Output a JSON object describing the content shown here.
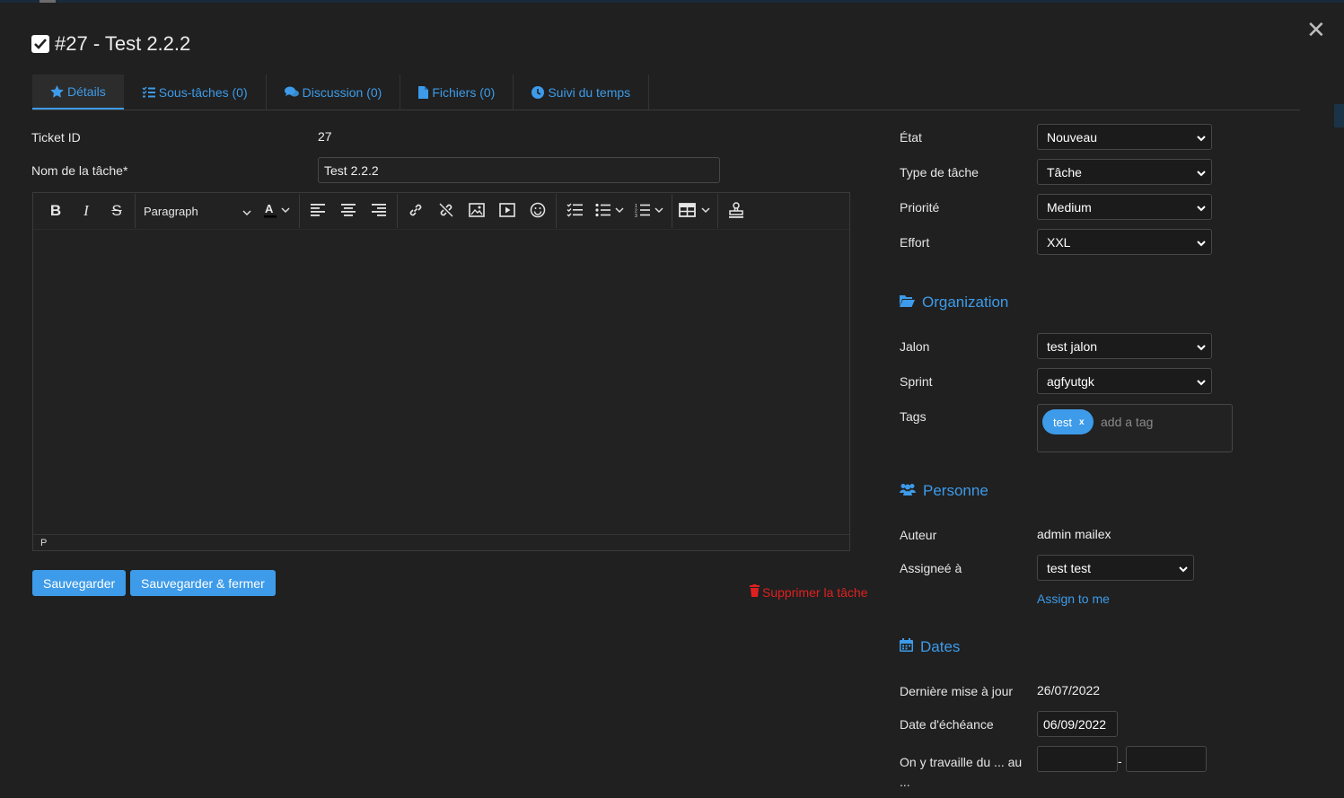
{
  "task": {
    "title": "#27 - Test 2.2.2"
  },
  "tabs": [
    {
      "label": "Détails",
      "icon": "star-icon"
    },
    {
      "label": "Sous-tâches (0)",
      "icon": "checklist-icon"
    },
    {
      "label": "Discussion (0)",
      "icon": "comments-icon"
    },
    {
      "label": "Fichiers (0)",
      "icon": "file-icon"
    },
    {
      "label": "Suivi du temps",
      "icon": "clock-icon"
    }
  ],
  "details": {
    "ticket_id_label": "Ticket ID",
    "ticket_id_value": "27",
    "name_label": "Nom de la tâche*",
    "name_value": "Test 2.2.2"
  },
  "editor": {
    "block_format": "Paragraph",
    "status_path": "P"
  },
  "actions": {
    "save": "Sauvegarder",
    "save_close": "Sauvegarder & fermer",
    "delete": "Supprimer la tâche"
  },
  "properties": [
    {
      "label": "État",
      "value": "Nouveau"
    },
    {
      "label": "Type de tâche",
      "value": "Tâche"
    },
    {
      "label": "Priorité",
      "value": "Medium"
    },
    {
      "label": "Effort",
      "value": "XXL"
    }
  ],
  "organization": {
    "heading": "Organization",
    "milestone_label": "Jalon",
    "milestone_value": "test jalon",
    "sprint_label": "Sprint",
    "sprint_value": "agfyutgk",
    "tags_label": "Tags",
    "tags": [
      "test"
    ],
    "tag_remove": "x",
    "tag_placeholder": "add a tag"
  },
  "person": {
    "heading": "Personne",
    "author_label": "Auteur",
    "author_value": "admin mailex",
    "assigned_label": "Assigneé à",
    "assigned_value": "test test",
    "assign_me": "Assign to me"
  },
  "dates": {
    "heading": "Dates",
    "updated_label": "Dernière mise à jour",
    "updated_value": "26/07/2022",
    "due_label": "Date d'échéance",
    "due_value": "06/09/2022",
    "work_label": "On y travaille du ... au ...",
    "work_separator": "-",
    "work_from": "",
    "work_to": ""
  },
  "colors": {
    "accent": "#3d9be9",
    "danger": "#e02020",
    "background": "#202020"
  }
}
